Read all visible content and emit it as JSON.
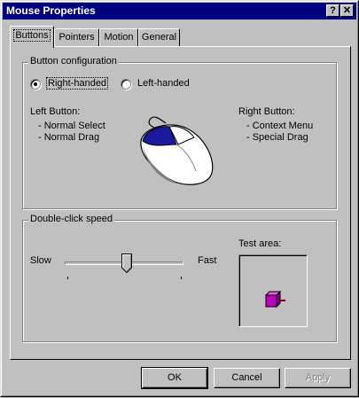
{
  "window": {
    "title": "Mouse Properties",
    "help_glyph": "?",
    "close_glyph": "✕"
  },
  "tabs": [
    {
      "label": "Buttons",
      "active": true
    },
    {
      "label": "Pointers",
      "active": false
    },
    {
      "label": "Motion",
      "active": false
    },
    {
      "label": "General",
      "active": false
    }
  ],
  "button_config": {
    "legend": "Button configuration",
    "right_handed": "Right-handed",
    "left_handed": "Left-handed",
    "selected": "right_handed",
    "left_button": {
      "heading": "Left Button:",
      "items": [
        "-  Normal Select",
        "-  Normal Drag"
      ]
    },
    "right_button": {
      "heading": "Right Button:",
      "items": [
        "-  Context Menu",
        "-  Special Drag"
      ]
    }
  },
  "double_click": {
    "legend": "Double-click speed",
    "slow": "Slow",
    "fast": "Fast",
    "speed_fraction": 0.52,
    "test_area_label": "Test area:"
  },
  "buttons": {
    "ok": "OK",
    "cancel": "Cancel",
    "apply": "Apply"
  },
  "colors": {
    "title_bar": "#000080",
    "face": "#c0c0c0",
    "mouse_highlight": "#1a1a9c",
    "test_box": "#c000c0"
  }
}
